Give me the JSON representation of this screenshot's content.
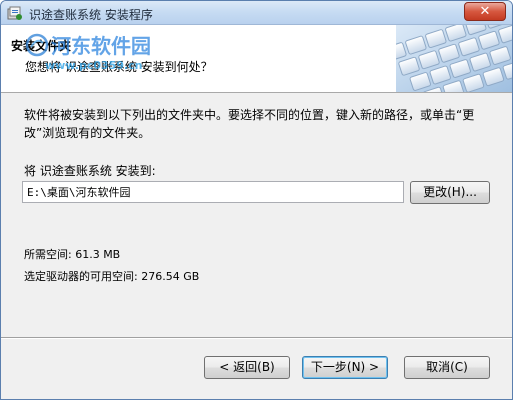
{
  "window": {
    "title": "识途查账系统 安装程序",
    "close_label": "✕"
  },
  "watermark": {
    "name": "河东软件园",
    "url": "www.pc0359.cn"
  },
  "header": {
    "title": "安装文件夹",
    "subtitle": "您想将 识途查账系统 安装到何处？"
  },
  "main": {
    "description": "软件将被安装到以下列出的文件夹中。要选择不同的位置，键入新的路径，或单击“更改”浏览现有的文件夹。",
    "install_to_label": "将 识途查账系统 安装到:",
    "install_path": "E:\\桌面\\河东软件园",
    "browse_label": "更改(H)...",
    "space_required": "所需空间: 61.3 MB",
    "space_available": "选定驱动器的可用空间: 276.54 GB"
  },
  "footer": {
    "back_label": "< 返回(B)",
    "next_label": "下一步(N) >",
    "cancel_label": "取消(C)"
  }
}
